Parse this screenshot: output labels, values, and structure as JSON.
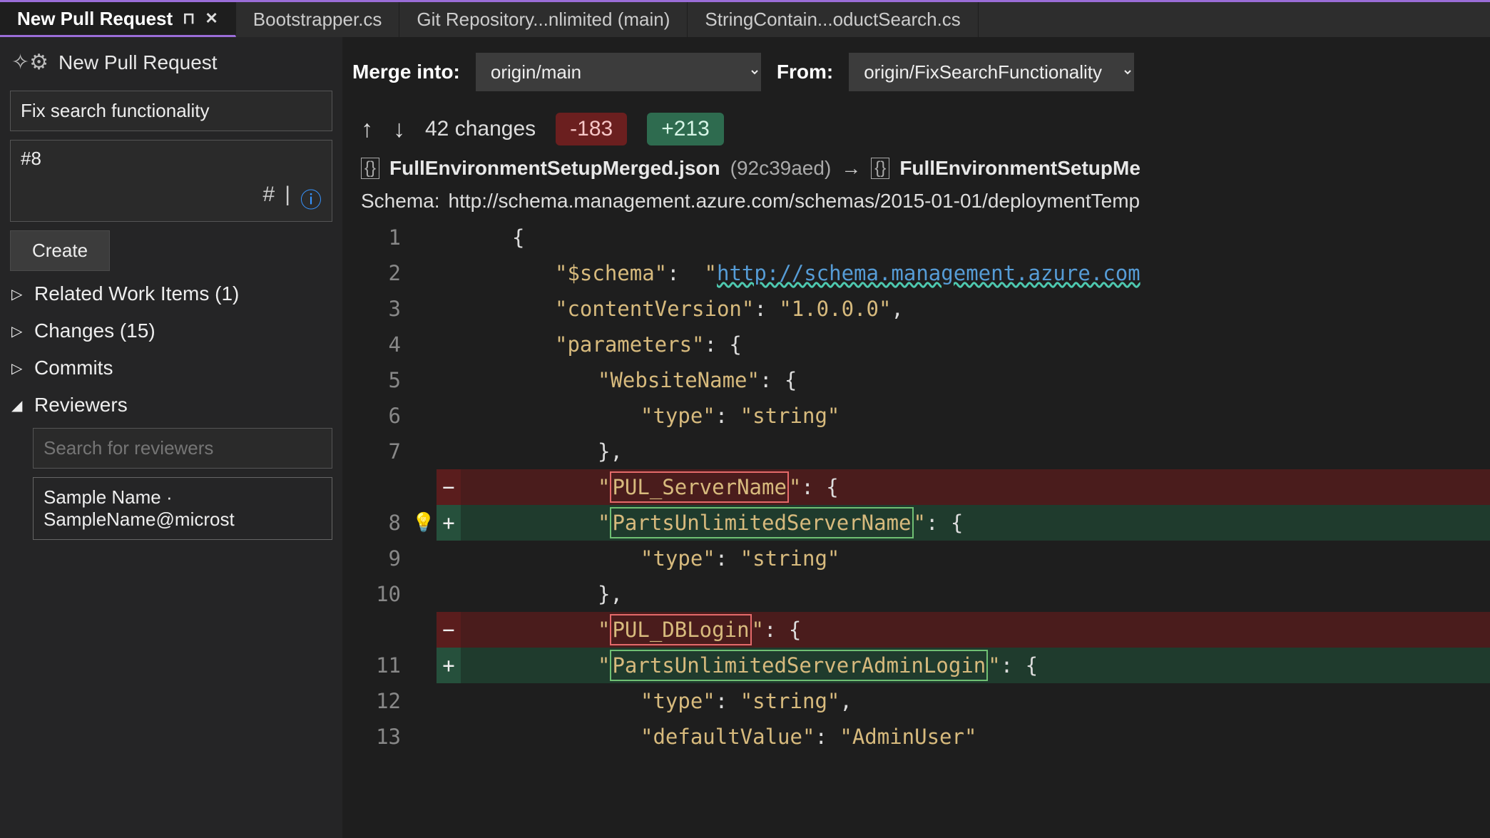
{
  "tabs": [
    {
      "label": "New Pull Request",
      "active": true
    },
    {
      "label": "Bootstrapper.cs",
      "active": false
    },
    {
      "label": "Git Repository...nlimited (main)",
      "active": false
    },
    {
      "label": "StringContain...oductSearch.cs",
      "active": false
    }
  ],
  "pr": {
    "icon_title": "New Pull Request",
    "merge_into_label": "Merge into:",
    "from_label": "From:",
    "merge_into_value": "origin/main",
    "from_value": "origin/FixSearchFunctionality",
    "title_value": "Fix search functionality",
    "desc_value": "#8",
    "create_label": "Create"
  },
  "tree": {
    "related": "Related Work Items (1)",
    "changes": "Changes (15)",
    "commits": "Commits",
    "reviewers": "Reviewers",
    "reviewer_search_placeholder": "Search for reviewers",
    "reviewer_chip": "Sample Name · SampleName@microst"
  },
  "diff": {
    "changes_text": "42 changes",
    "del_text": "-183",
    "add_text": "+213",
    "file_left": "FullEnvironmentSetupMerged.json",
    "file_left_hash": "(92c39aed)",
    "arrow": "→",
    "file_right": "FullEnvironmentSetupMe",
    "schema_label": "Schema:",
    "schema_url": "http://schema.management.azure.com/schemas/2015-01-01/deploymentTemp"
  },
  "code": {
    "l1": "{",
    "l2a": "\"$schema\"",
    "l2b": "\"",
    "l2c": "http://schema.management.azure.com",
    "l3a": "\"contentVersion\"",
    "l3b": "\"1.0.0.0\"",
    "l4a": "\"parameters\"",
    "l5a": "\"WebsiteName\"",
    "l6a": "\"type\"",
    "l6b": "\"string\"",
    "l7a": "},",
    "l8del": "PUL_ServerName",
    "l8add": "PartsUnlimitedServerName",
    "l9a": "\"type\"",
    "l9b": "\"string\"",
    "l10a": "},",
    "l11del": "PUL_DBLogin",
    "l11add": "PartsUnlimitedServerAdminLogin",
    "l12a": "\"type\"",
    "l12b": "\"string\"",
    "l13a": "\"defaultValue\"",
    "l13b": "\"AdminUser\""
  },
  "gutter": [
    "1",
    "2",
    "3",
    "4",
    "5",
    "6",
    "7",
    "",
    "8",
    "9",
    "10",
    "",
    "11",
    "12",
    "13"
  ]
}
